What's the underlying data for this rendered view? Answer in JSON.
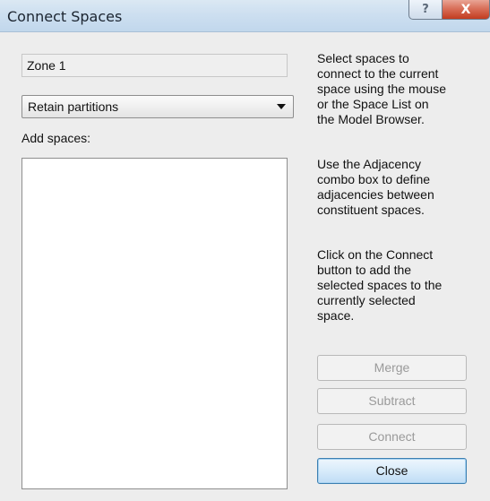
{
  "window": {
    "title": "Connect Spaces",
    "help_glyph": "?",
    "close_glyph": "X"
  },
  "form": {
    "zone_name": "Zone 1",
    "adjacency_selected": "Retain partitions",
    "add_spaces_label": "Add spaces:",
    "spaces_list": []
  },
  "help": {
    "paragraph1": "Select spaces to\nconnect to the current\nspace using the mouse\nor the Space List on\nthe Model Browser.",
    "paragraph2": "Use the Adjacency\ncombo box to define\nadjacencies between\nconstituent spaces.",
    "paragraph3": "Click on the Connect\nbutton to add the\nselected spaces to the\ncurrently selected\nspace."
  },
  "buttons": {
    "merge": "Merge",
    "subtract": "Subtract",
    "connect": "Connect",
    "close": "Close"
  },
  "icons": {
    "help": "help-icon",
    "close": "close-icon",
    "dropdown": "chevron-down-icon"
  }
}
